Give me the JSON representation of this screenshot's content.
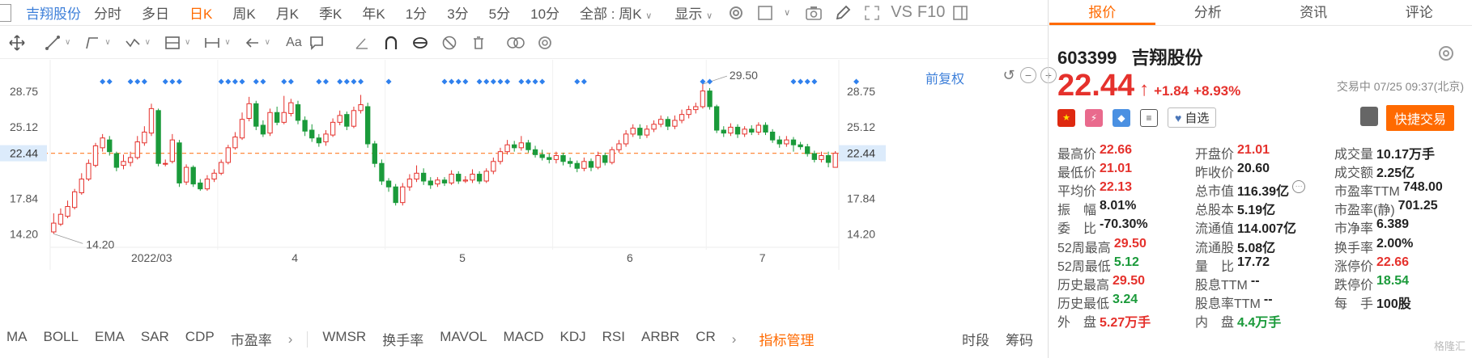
{
  "top_bar": {
    "stock_name": "吉翔股份",
    "periods": [
      "分时",
      "多日",
      "日K",
      "周K",
      "月K",
      "季K",
      "年K",
      "1分",
      "3分",
      "5分",
      "10分"
    ],
    "active_period": "日K",
    "scope_select": "全部 : 周K",
    "display_label": "显示",
    "vs_label": "VS",
    "f10_label": "F10"
  },
  "chart": {
    "adjust_label": "前复权",
    "price_labels_left": [
      "28.75",
      "25.12",
      "22.44",
      "17.84",
      "14.20"
    ],
    "price_labels_right": [
      "28.75",
      "25.12",
      "22.44",
      "17.84",
      "14.20"
    ],
    "high_marker": "29.50",
    "low_marker": "14.20",
    "x_labels": [
      "2022/03",
      "4",
      "5",
      "6",
      "7"
    ],
    "current_price_line": "22.44"
  },
  "chart_data": {
    "type": "candlestick",
    "title": "",
    "ylim": [
      12.5,
      30.5
    ],
    "y_ticks": [
      14.2,
      17.84,
      22.44,
      25.12,
      28.75
    ],
    "x_ticks": [
      "2022/03",
      "4",
      "5",
      "6",
      "7"
    ],
    "current_price": 22.44,
    "period_high": 29.5,
    "period_low": 14.2,
    "up_color": "#e5312c",
    "down_color": "#1a9a3a",
    "candles": [
      [
        14.4,
        15.3,
        16.3,
        14.2
      ],
      [
        15.2,
        16.2,
        16.8,
        15.0
      ],
      [
        16.0,
        17.0,
        17.6,
        15.8
      ],
      [
        16.9,
        18.5,
        18.8,
        16.7
      ],
      [
        18.4,
        19.8,
        20.4,
        18.2
      ],
      [
        19.8,
        21.4,
        21.8,
        19.6
      ],
      [
        21.2,
        23.2,
        23.5,
        21.0
      ],
      [
        23.0,
        24.0,
        24.4,
        22.6
      ],
      [
        23.8,
        22.6,
        24.2,
        22.2
      ],
      [
        22.4,
        21.0,
        22.6,
        20.6
      ],
      [
        21.2,
        21.6,
        22.3,
        20.8
      ],
      [
        21.5,
        22.0,
        22.6,
        21.1
      ],
      [
        22.0,
        23.6,
        24.2,
        21.8
      ],
      [
        23.5,
        24.6,
        25.2,
        23.2
      ],
      [
        24.5,
        27.0,
        27.5,
        24.2
      ],
      [
        26.8,
        21.4,
        27.0,
        21.1
      ],
      [
        21.4,
        21.4,
        21.8,
        21.1
      ],
      [
        21.6,
        23.8,
        24.4,
        21.4
      ],
      [
        23.5,
        19.4,
        23.8,
        19.0
      ],
      [
        19.5,
        21.0,
        21.3,
        19.2
      ],
      [
        21.0,
        19.3,
        21.2,
        19.0
      ],
      [
        19.4,
        18.8,
        19.8,
        18.6
      ],
      [
        18.8,
        19.8,
        20.2,
        18.6
      ],
      [
        19.8,
        20.4,
        20.8,
        19.5
      ],
      [
        20.4,
        21.5,
        21.8,
        20.2
      ],
      [
        21.5,
        23.0,
        23.3,
        21.3
      ],
      [
        23.0,
        24.1,
        24.6,
        22.8
      ],
      [
        24.0,
        25.9,
        26.6,
        23.8
      ],
      [
        26.0,
        27.5,
        28.2,
        25.7
      ],
      [
        27.5,
        25.2,
        27.8,
        24.8
      ],
      [
        25.3,
        24.4,
        25.8,
        24.1
      ],
      [
        24.5,
        26.6,
        27.0,
        24.2
      ],
      [
        26.6,
        25.6,
        27.2,
        25.3
      ],
      [
        25.6,
        26.6,
        28.3,
        25.4
      ],
      [
        26.5,
        27.6,
        28.0,
        26.2
      ],
      [
        27.4,
        25.8,
        27.8,
        25.4
      ],
      [
        25.8,
        24.7,
        26.2,
        24.2
      ],
      [
        24.8,
        24.0,
        25.4,
        23.6
      ],
      [
        24.0,
        23.5,
        24.4,
        23.1
      ],
      [
        23.6,
        24.4,
        24.8,
        23.2
      ],
      [
        24.3,
        25.6,
        26.0,
        24.1
      ],
      [
        25.6,
        26.3,
        26.8,
        25.3
      ],
      [
        26.4,
        25.2,
        26.7,
        24.8
      ],
      [
        25.2,
        26.8,
        27.2,
        25.0
      ],
      [
        26.8,
        27.4,
        28.4,
        26.5
      ],
      [
        27.2,
        23.4,
        27.6,
        23.0
      ],
      [
        23.4,
        21.4,
        23.7,
        21.0
      ],
      [
        21.4,
        19.6,
        21.8,
        19.2
      ],
      [
        19.6,
        19.0,
        19.9,
        18.5
      ],
      [
        19.0,
        17.4,
        19.3,
        17.1
      ],
      [
        17.4,
        19.0,
        19.4,
        17.1
      ],
      [
        19.0,
        19.8,
        20.3,
        18.6
      ],
      [
        19.8,
        20.4,
        21.2,
        19.5
      ],
      [
        20.4,
        19.6,
        20.9,
        19.2
      ],
      [
        19.6,
        19.2,
        20.0,
        18.8
      ],
      [
        19.3,
        19.7,
        20.0,
        19.0
      ],
      [
        19.7,
        19.4,
        20.0,
        19.1
      ],
      [
        19.4,
        20.3,
        20.7,
        19.2
      ],
      [
        20.3,
        19.6,
        20.6,
        19.3
      ],
      [
        19.6,
        19.7,
        20.1,
        19.4
      ],
      [
        19.7,
        20.3,
        20.8,
        19.4
      ],
      [
        20.3,
        19.6,
        20.6,
        19.3
      ],
      [
        19.6,
        20.6,
        20.9,
        19.4
      ],
      [
        20.6,
        21.6,
        22.0,
        20.3
      ],
      [
        21.6,
        22.6,
        23.0,
        21.3
      ],
      [
        22.6,
        23.3,
        23.8,
        22.3
      ],
      [
        23.3,
        23.0,
        23.7,
        22.6
      ],
      [
        23.0,
        23.5,
        24.2,
        22.7
      ],
      [
        23.5,
        22.8,
        23.8,
        22.5
      ],
      [
        22.8,
        22.3,
        23.2,
        22.0
      ],
      [
        22.3,
        22.0,
        22.8,
        21.7
      ],
      [
        22.0,
        21.8,
        22.4,
        21.4
      ],
      [
        21.8,
        22.2,
        22.6,
        21.4
      ],
      [
        22.2,
        21.6,
        22.5,
        21.2
      ],
      [
        21.6,
        21.4,
        22.0,
        21.0
      ],
      [
        21.4,
        20.9,
        21.7,
        20.5
      ],
      [
        20.9,
        21.6,
        22.0,
        20.6
      ],
      [
        21.6,
        21.0,
        21.9,
        20.6
      ],
      [
        21.0,
        22.2,
        22.6,
        20.8
      ],
      [
        22.2,
        21.5,
        22.5,
        21.2
      ],
      [
        21.5,
        22.8,
        23.1,
        21.3
      ],
      [
        22.8,
        23.4,
        23.8,
        22.5
      ],
      [
        23.4,
        24.4,
        24.8,
        23.1
      ],
      [
        24.4,
        25.0,
        25.4,
        24.1
      ],
      [
        25.0,
        24.3,
        25.4,
        23.9
      ],
      [
        24.3,
        24.9,
        25.3,
        24.0
      ],
      [
        24.9,
        25.4,
        25.8,
        24.6
      ],
      [
        25.4,
        25.9,
        26.3,
        25.1
      ],
      [
        25.9,
        25.2,
        26.2,
        24.8
      ],
      [
        25.2,
        25.8,
        26.3,
        24.9
      ],
      [
        25.8,
        26.4,
        26.9,
        25.5
      ],
      [
        26.4,
        26.9,
        27.3,
        26.0
      ],
      [
        26.9,
        27.2,
        27.6,
        26.5
      ],
      [
        27.2,
        28.8,
        29.5,
        27.0
      ],
      [
        28.8,
        27.2,
        29.1,
        26.9
      ],
      [
        27.2,
        24.8,
        27.4,
        24.5
      ],
      [
        24.8,
        24.5,
        25.2,
        24.1
      ],
      [
        24.5,
        25.1,
        25.5,
        24.2
      ],
      [
        25.1,
        24.4,
        25.4,
        24.0
      ],
      [
        24.4,
        24.9,
        25.2,
        24.1
      ],
      [
        24.9,
        24.6,
        25.3,
        24.3
      ],
      [
        24.6,
        25.3,
        25.6,
        24.3
      ],
      [
        25.3,
        24.6,
        25.6,
        24.3
      ],
      [
        24.6,
        23.8,
        24.9,
        23.5
      ],
      [
        23.8,
        23.4,
        24.2,
        23.0
      ],
      [
        23.4,
        23.8,
        24.2,
        23.1
      ],
      [
        23.8,
        23.3,
        24.1,
        22.6
      ],
      [
        23.3,
        23.1,
        23.6,
        22.8
      ],
      [
        23.1,
        22.4,
        23.4,
        22.1
      ],
      [
        22.4,
        21.8,
        22.7,
        21.5
      ],
      [
        21.8,
        22.2,
        22.6,
        21.5
      ],
      [
        22.2,
        21.5,
        22.6,
        21.0
      ],
      [
        21.0,
        22.44,
        22.66,
        21.01
      ]
    ],
    "signal_markers": [
      [
        7,
        8
      ],
      [
        11,
        12,
        13
      ],
      [
        16,
        17,
        18
      ],
      [
        24,
        25,
        26,
        27
      ],
      [
        29,
        30
      ],
      [
        33,
        34
      ],
      [
        38,
        39
      ],
      [
        41,
        42,
        43,
        44
      ],
      [
        48
      ],
      [
        56,
        57,
        58,
        59
      ],
      [
        61,
        62,
        63,
        64,
        65
      ],
      [
        67,
        68,
        69,
        70
      ],
      [
        75,
        76
      ],
      [
        93,
        94
      ],
      [
        106,
        107,
        108,
        109
      ],
      [
        115
      ]
    ]
  },
  "indicators": {
    "main": [
      "MA",
      "BOLL",
      "EMA",
      "SAR",
      "CDP",
      "市盈率"
    ],
    "sub": [
      "WMSR",
      "换手率",
      "MAVOL",
      "MACD",
      "KDJ",
      "RSI",
      "ARBR",
      "CR"
    ],
    "manager": "指标管理",
    "extra": [
      "时段",
      "筹码"
    ]
  },
  "quote": {
    "tabs": [
      "报价",
      "分析",
      "资讯",
      "评论"
    ],
    "active_tab": "报价",
    "code": "603399",
    "name": "吉翔股份",
    "price": "22.44",
    "change": "+1.84",
    "change_pct": "+8.93%",
    "status": "交易中 07/25 09:37(北京)",
    "watch_label": "自选",
    "quick_trade": "快捷交易",
    "fields": [
      [
        {
          "label": "最高价",
          "value": "22.66",
          "cls": "up"
        },
        {
          "label": "开盘价",
          "value": "21.01",
          "cls": "up"
        },
        {
          "label": "成交量",
          "value": "10.17万手",
          "cls": ""
        }
      ],
      [
        {
          "label": "最低价",
          "value": "21.01",
          "cls": "up"
        },
        {
          "label": "昨收价",
          "value": "20.60",
          "cls": ""
        },
        {
          "label": "成交额",
          "value": "2.25亿",
          "cls": ""
        }
      ],
      [
        {
          "label": "平均价",
          "value": "22.13",
          "cls": "up"
        },
        {
          "label": "总市值",
          "value": "116.39亿",
          "cls": ""
        },
        {
          "label": "市盈率TTM",
          "value": "748.00",
          "cls": ""
        }
      ],
      [
        {
          "label": "振　幅",
          "value": "8.01%",
          "cls": ""
        },
        {
          "label": "总股本",
          "value": "5.19亿",
          "cls": ""
        },
        {
          "label": "市盈率(静)",
          "value": "701.25",
          "cls": ""
        }
      ],
      [
        {
          "label": "委　比",
          "value": "-70.30%",
          "cls": ""
        },
        {
          "label": "流通值",
          "value": "114.007亿",
          "cls": ""
        },
        {
          "label": "市净率",
          "value": "6.389",
          "cls": ""
        }
      ],
      [
        {
          "label": "52周最高",
          "value": "29.50",
          "cls": "up"
        },
        {
          "label": "流通股",
          "value": "5.08亿",
          "cls": ""
        },
        {
          "label": "换手率",
          "value": "2.00%",
          "cls": ""
        }
      ],
      [
        {
          "label": "52周最低",
          "value": "5.12",
          "cls": "down"
        },
        {
          "label": "量　比",
          "value": "17.72",
          "cls": ""
        },
        {
          "label": "涨停价",
          "value": "22.66",
          "cls": "up"
        }
      ],
      [
        {
          "label": "历史最高",
          "value": "29.50",
          "cls": "up"
        },
        {
          "label": "股息TTM",
          "value": "--",
          "cls": ""
        },
        {
          "label": "跌停价",
          "value": "18.54",
          "cls": "down"
        }
      ],
      [
        {
          "label": "历史最低",
          "value": "3.24",
          "cls": "down"
        },
        {
          "label": "股息率TTM",
          "value": "--",
          "cls": ""
        },
        {
          "label": "每　手",
          "value": "100股",
          "cls": ""
        }
      ],
      [
        {
          "label": "外　盘",
          "value": "5.27万手",
          "cls": "up"
        },
        {
          "label": "内　盘",
          "value": "4.4万手",
          "cls": "down"
        },
        {
          "label": "",
          "value": "",
          "cls": ""
        }
      ]
    ],
    "watermark": "格隆汇"
  }
}
